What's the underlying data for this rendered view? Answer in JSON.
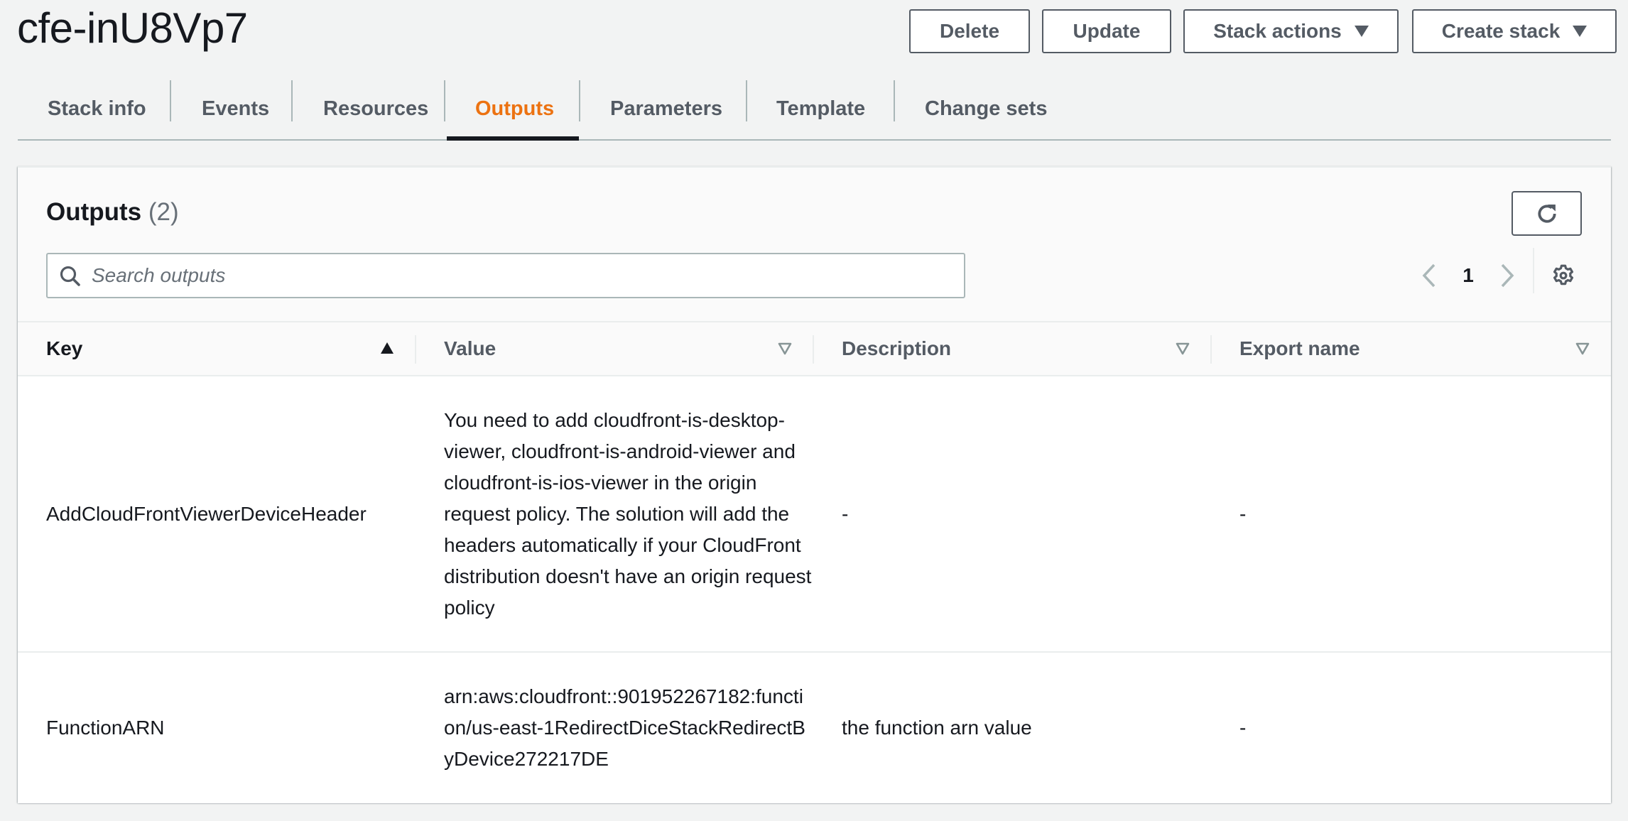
{
  "header": {
    "title": "cfe-inU8Vp7",
    "buttons": {
      "delete": "Delete",
      "update": "Update",
      "stack_actions": "Stack actions",
      "create_stack": "Create stack"
    }
  },
  "tabs": [
    {
      "label": "Stack info",
      "active": false
    },
    {
      "label": "Events",
      "active": false
    },
    {
      "label": "Resources",
      "active": false
    },
    {
      "label": "Outputs",
      "active": true
    },
    {
      "label": "Parameters",
      "active": false
    },
    {
      "label": "Template",
      "active": false
    },
    {
      "label": "Change sets",
      "active": false
    }
  ],
  "colors": {
    "active_tab": "#ec7211",
    "text_primary": "#16191f",
    "text_secondary": "#545b64",
    "border": "#aab7b8",
    "background": "#f2f3f3"
  },
  "outputs_panel": {
    "heading": "Outputs",
    "count": "(2)",
    "refresh_icon": "refresh-icon",
    "search": {
      "placeholder": "Search outputs",
      "value": "",
      "icon": "search-icon"
    },
    "pagination": {
      "current_page": "1",
      "prev_icon": "chevron-left-icon",
      "next_icon": "chevron-right-icon",
      "settings_icon": "gear-icon"
    },
    "table": {
      "columns": [
        {
          "label": "Key",
          "sort": "ascending"
        },
        {
          "label": "Value",
          "sort": "none"
        },
        {
          "label": "Description",
          "sort": "none"
        },
        {
          "label": "Export name",
          "sort": "none"
        }
      ],
      "rows": [
        {
          "key": "AddCloudFrontViewerDeviceHeader",
          "value": "You need to add cloudfront-is-desktop-viewer, cloudfront-is-android-viewer and cloudfront-is-ios-viewer in the origin request policy. The solution will add the headers automatically if your CloudFront distribution doesn't have an origin request policy",
          "description": "-",
          "export_name": "-"
        },
        {
          "key": "FunctionARN",
          "value": "arn:aws:cloudfront::901952267182:function/us-east-1RedirectDiceStackRedirectByDevice272217DE",
          "description": "the function arn value",
          "export_name": "-"
        }
      ]
    }
  }
}
